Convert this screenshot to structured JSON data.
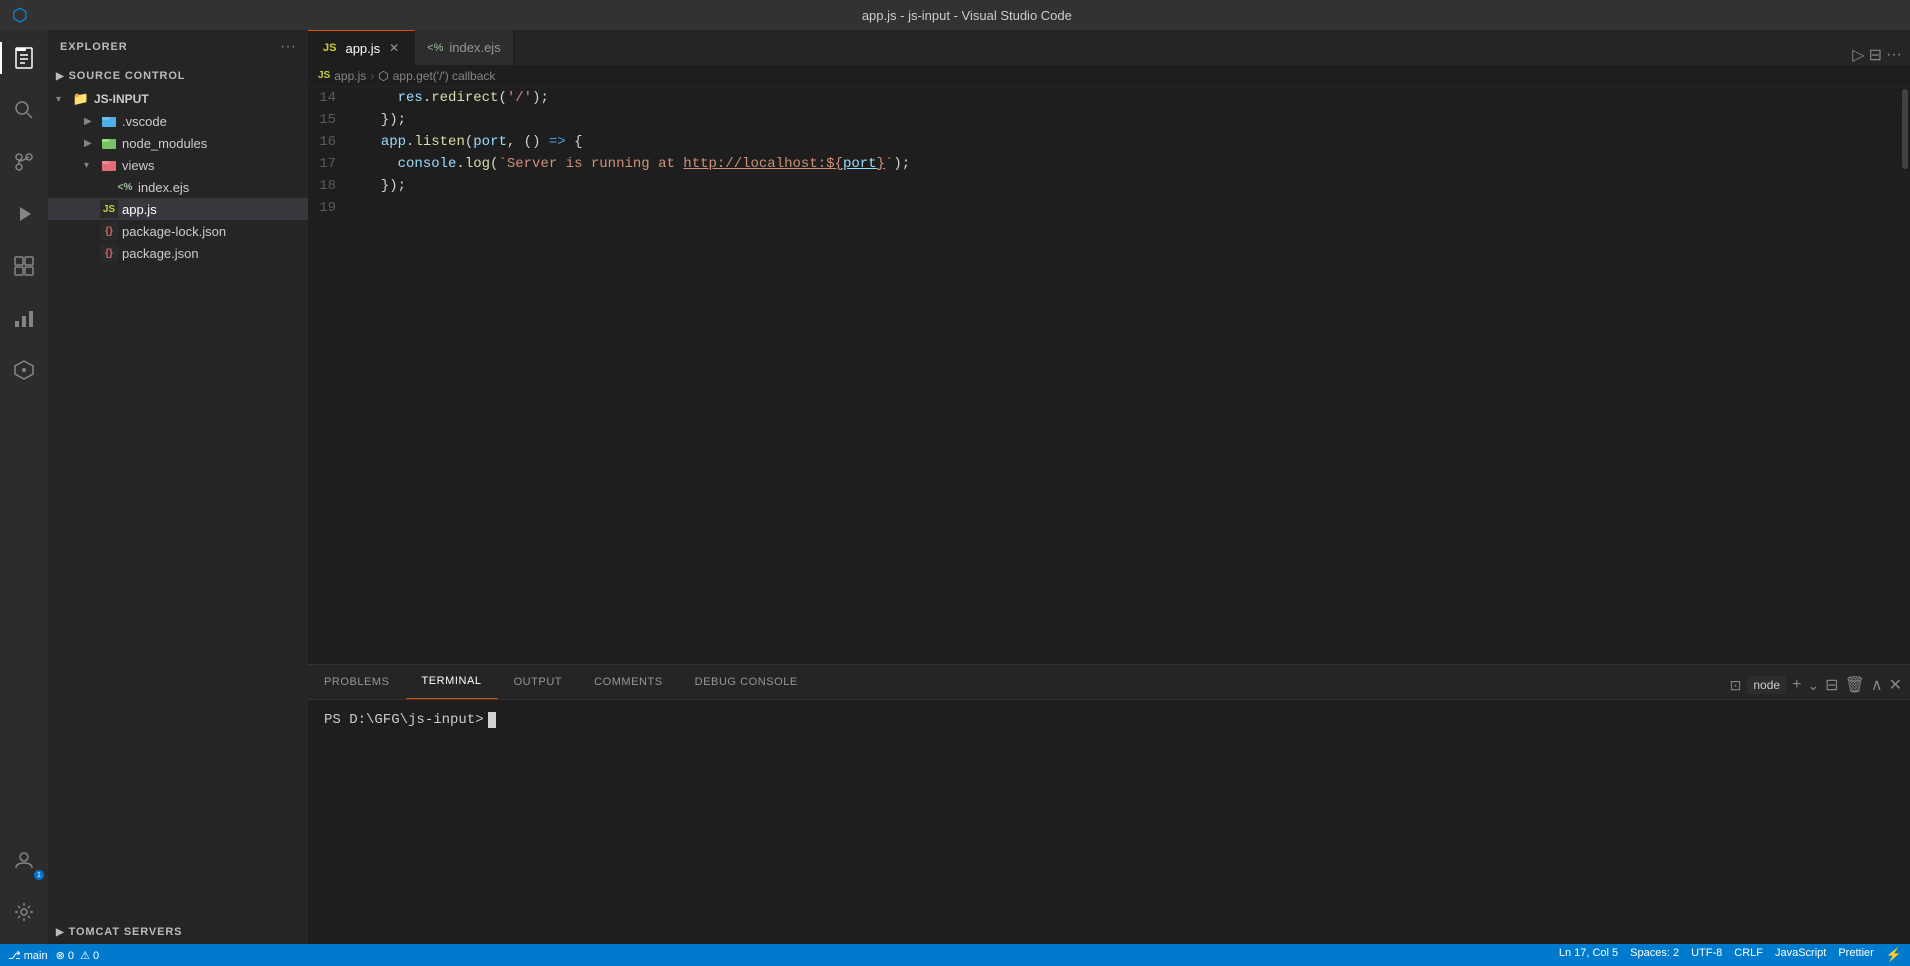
{
  "titlebar": {
    "title": "app.js - js-input - Visual Studio Code"
  },
  "activitybar": {
    "icons": [
      {
        "name": "explorer-icon",
        "glyph": "⧉",
        "active": true
      },
      {
        "name": "search-icon",
        "glyph": "🔍",
        "active": false
      },
      {
        "name": "source-control-icon",
        "glyph": "⎇",
        "active": false
      },
      {
        "name": "run-debug-icon",
        "glyph": "▷",
        "active": false
      },
      {
        "name": "extensions-icon",
        "glyph": "⊞",
        "active": false
      },
      {
        "name": "charts-icon",
        "glyph": "▦",
        "active": false
      },
      {
        "name": "remote-icon",
        "glyph": "⚡",
        "active": false
      }
    ],
    "bottom_icons": [
      {
        "name": "account-icon",
        "glyph": "◯",
        "badge": "1"
      },
      {
        "name": "settings-icon",
        "glyph": "⚙"
      }
    ]
  },
  "sidebar": {
    "header_title": "EXPLORER",
    "source_control_label": "SOURCE CONTROL",
    "folder_name": "JS-INPUT",
    "items": [
      {
        "label": ".vscode",
        "type": "folder",
        "indent": 2,
        "expanded": false,
        "icon": "vscode-folder"
      },
      {
        "label": "node_modules",
        "type": "folder",
        "indent": 2,
        "expanded": false,
        "icon": "npm-folder"
      },
      {
        "label": "views",
        "type": "folder",
        "indent": 2,
        "expanded": true,
        "icon": "views-folder"
      },
      {
        "label": "index.ejs",
        "type": "ejs",
        "indent": 3,
        "icon": "ejs-icon"
      },
      {
        "label": "app.js",
        "type": "js",
        "indent": 2,
        "active": true,
        "icon": "js-icon"
      },
      {
        "label": "package-lock.json",
        "type": "json",
        "indent": 2,
        "icon": "json-icon"
      },
      {
        "label": "package.json",
        "type": "json",
        "indent": 2,
        "icon": "json-icon"
      }
    ],
    "tomcat_label": "TOMCAT SERVERS"
  },
  "tabs": [
    {
      "label": "app.js",
      "type": "js",
      "active": true,
      "closeable": true
    },
    {
      "label": "index.ejs",
      "type": "ejs",
      "active": false,
      "closeable": false
    }
  ],
  "breadcrumb": {
    "parts": [
      "app.js",
      "app.get('/') callback"
    ]
  },
  "code": {
    "lines": [
      {
        "num": "14",
        "content": "    res.redirect('/');",
        "tokens": [
          {
            "t": "    ",
            "c": "op"
          },
          {
            "t": "res",
            "c": "var"
          },
          {
            "t": ".",
            "c": "op"
          },
          {
            "t": "redirect",
            "c": "fn"
          },
          {
            "t": "('",
            "c": "op"
          },
          {
            "t": "/",
            "c": "str"
          },
          {
            "t": "');",
            "c": "op"
          }
        ]
      },
      {
        "num": "15",
        "content": "  });",
        "tokens": [
          {
            "t": "  });",
            "c": "op"
          }
        ]
      },
      {
        "num": "16",
        "content": "  app.listen(port, () => {",
        "tokens": [
          {
            "t": "  ",
            "c": "op"
          },
          {
            "t": "app",
            "c": "var"
          },
          {
            "t": ".",
            "c": "op"
          },
          {
            "t": "listen",
            "c": "fn"
          },
          {
            "t": "(",
            "c": "op"
          },
          {
            "t": "port",
            "c": "var"
          },
          {
            "t": ", () => {",
            "c": "op"
          }
        ]
      },
      {
        "num": "17",
        "content": "    console.log(`Server is running at http://localhost:${port}`);",
        "tokens": [
          {
            "t": "    ",
            "c": "op"
          },
          {
            "t": "console",
            "c": "var"
          },
          {
            "t": ".",
            "c": "op"
          },
          {
            "t": "log",
            "c": "fn"
          },
          {
            "t": "(`Server is running at ",
            "c": "str"
          },
          {
            "t": "http://localhost:${port}",
            "c": "url"
          },
          {
            "t": "`);",
            "c": "str"
          }
        ]
      },
      {
        "num": "18",
        "content": "  });",
        "tokens": [
          {
            "t": "  });",
            "c": "op"
          }
        ]
      },
      {
        "num": "19",
        "content": "",
        "tokens": []
      }
    ]
  },
  "panel": {
    "tabs": [
      {
        "label": "PROBLEMS",
        "active": false
      },
      {
        "label": "TERMINAL",
        "active": true
      },
      {
        "label": "OUTPUT",
        "active": false
      },
      {
        "label": "COMMENTS",
        "active": false
      },
      {
        "label": "DEBUG CONSOLE",
        "active": false
      }
    ],
    "terminal_label": "node",
    "terminal_prompt": "PS D:\\GFG\\js-input> "
  },
  "statusbar": {
    "left": [
      "⎇  main",
      "⊗ 0  ⚠ 0"
    ],
    "right": [
      "Ln 17, Col 5",
      "Spaces: 2",
      "UTF-8",
      "CRLF",
      "JavaScript",
      "Prettier",
      "⚡"
    ]
  }
}
